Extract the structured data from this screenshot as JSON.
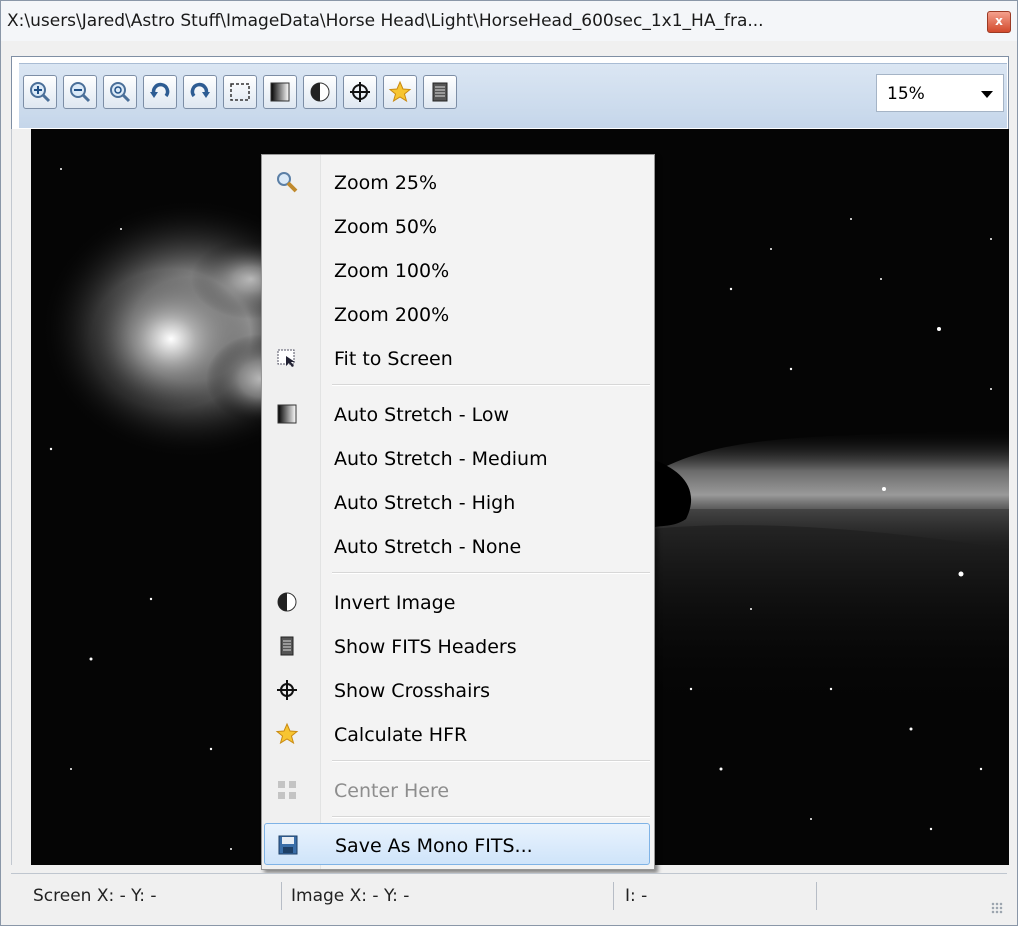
{
  "window": {
    "title": "X:\\users\\Jared\\Astro Stuff\\ImageData\\Horse Head\\Light\\HorseHead_600sec_1x1_HA_fra...",
    "close_label": "x"
  },
  "toolbar": {
    "buttons": [
      {
        "name": "zoom-in-button",
        "icon": "zoom-in-icon"
      },
      {
        "name": "zoom-out-button",
        "icon": "zoom-out-icon"
      },
      {
        "name": "zoom-fit-button",
        "icon": "zoom-fit-icon"
      },
      {
        "name": "rotate-left-button",
        "icon": "rotate-left-icon"
      },
      {
        "name": "rotate-right-button",
        "icon": "rotate-right-icon"
      },
      {
        "name": "select-region-button",
        "icon": "select-region-icon"
      },
      {
        "name": "auto-stretch-button",
        "icon": "stretch-gradient-icon"
      },
      {
        "name": "invert-button",
        "icon": "invert-icon"
      },
      {
        "name": "crosshairs-button",
        "icon": "crosshairs-icon"
      },
      {
        "name": "hfr-button",
        "icon": "star-icon"
      },
      {
        "name": "fits-headers-button",
        "icon": "document-icon"
      }
    ],
    "zoom_value": "15%"
  },
  "context_menu": {
    "items": [
      {
        "label": "Zoom 25%",
        "icon": "magnifier-icon"
      },
      {
        "label": "Zoom 50%",
        "icon": ""
      },
      {
        "label": "Zoom 100%",
        "icon": ""
      },
      {
        "label": "Zoom 200%",
        "icon": ""
      },
      {
        "label": "Fit to Screen",
        "icon": "fit-screen-icon"
      },
      {
        "label": "Auto Stretch - Low",
        "icon": "stretch-gradient-icon"
      },
      {
        "label": "Auto Stretch - Medium",
        "icon": ""
      },
      {
        "label": "Auto Stretch - High",
        "icon": ""
      },
      {
        "label": "Auto Stretch - None",
        "icon": ""
      },
      {
        "label": "Invert Image",
        "icon": "invert-icon"
      },
      {
        "label": "Show FITS Headers",
        "icon": "document-icon"
      },
      {
        "label": "Show Crosshairs",
        "icon": "crosshairs-icon"
      },
      {
        "label": "Calculate HFR",
        "icon": "star-icon"
      },
      {
        "label": "Center Here",
        "icon": "center-icon",
        "disabled": true
      },
      {
        "label": "Save As Mono FITS...",
        "icon": "save-icon",
        "selected": true
      }
    ]
  },
  "statusbar": {
    "screen": "Screen X: - Y: -",
    "image": "Image X: - Y: -",
    "intensity": "I: -"
  }
}
